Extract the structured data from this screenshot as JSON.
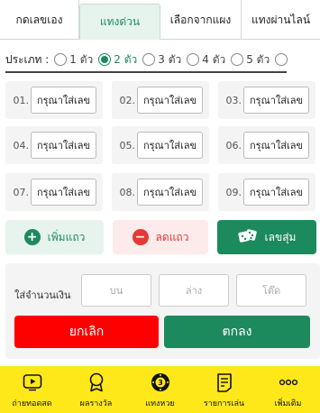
{
  "tabs": [
    {
      "label": "กดเลขเอง",
      "active": false
    },
    {
      "label": "แทงด่วน",
      "active": true
    },
    {
      "label": "เลือกจากแผง",
      "active": false
    },
    {
      "label": "แทงผ่านไลน์",
      "active": false
    }
  ],
  "type_row": {
    "label": "ประเภท :",
    "options": [
      {
        "label": "1 ตัว",
        "selected": false
      },
      {
        "label": "2 ตัว",
        "selected": true
      },
      {
        "label": "3 ตัว",
        "selected": false
      },
      {
        "label": "4 ตัว",
        "selected": false
      },
      {
        "label": "5 ตัว",
        "selected": false
      }
    ]
  },
  "number_grid": {
    "placeholder": "กรุณาใส่เลข",
    "cells": [
      {
        "num": "01."
      },
      {
        "num": "02."
      },
      {
        "num": "03."
      },
      {
        "num": "04."
      },
      {
        "num": "05."
      },
      {
        "num": "06."
      },
      {
        "num": "07."
      },
      {
        "num": "08."
      },
      {
        "num": "09."
      }
    ]
  },
  "actions": {
    "add_label": "เพิ่มแถว",
    "remove_label": "ลดแถว",
    "random_label": "เลขสุ่ม"
  },
  "amount": {
    "label": "ใส่จำนวนเงิน",
    "top_placeholder": "บน",
    "bottom_placeholder": "ล่าง",
    "tod_placeholder": "โต๊ด",
    "cancel_label": "ยกเลิก",
    "confirm_label": "ตกลง"
  },
  "bottom_nav": [
    {
      "label": "ถ่ายทอดสด",
      "icon": "play-icon"
    },
    {
      "label": "ผลรางวัล",
      "icon": "award-icon"
    },
    {
      "label": "แทงหวย",
      "icon": "lottery-ball-icon"
    },
    {
      "label": "รายการเล่น",
      "icon": "list-icon"
    },
    {
      "label": "เพิ่มเติม",
      "icon": "more-icon"
    }
  ],
  "colors": {
    "accent": "#1d8a5e",
    "danger": "#ff0000",
    "nav_bg": "#ffe81a"
  }
}
